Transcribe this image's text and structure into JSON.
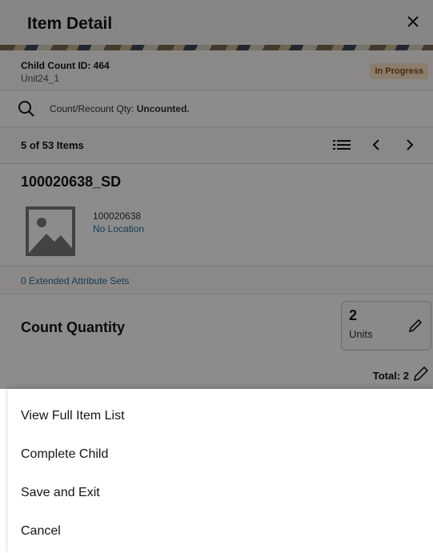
{
  "header": {
    "title": "Item Detail",
    "close_icon": "close-icon"
  },
  "child": {
    "id_label": "Child Count ID: 464",
    "unit": "Unit24_1",
    "status": "In Progress",
    "status_color": "#fbe3c7"
  },
  "search": {
    "prefix": "Count/Recount Qty: ",
    "value": "Uncounted."
  },
  "nav": {
    "count": "5 of 53 Items",
    "list_icon": "list-icon",
    "prev_icon": "chevron-left-icon",
    "next_icon": "chevron-right-icon"
  },
  "item": {
    "id": "100020638_SD",
    "number": "100020638",
    "location": "No Location",
    "image_icon": "image-placeholder-icon"
  },
  "extended": {
    "link": "0 Extended Attribute Sets"
  },
  "quantity": {
    "label": "Count Quantity",
    "value": "2",
    "unit": "Units",
    "total": "Total: 2"
  },
  "sheet": {
    "options": [
      "View Full Item List",
      "Complete Child",
      "Save and Exit",
      "Cancel"
    ]
  },
  "colors": {
    "accent_link": "#2b6c9e",
    "overlay": "rgba(0,0,0,0.45)"
  }
}
